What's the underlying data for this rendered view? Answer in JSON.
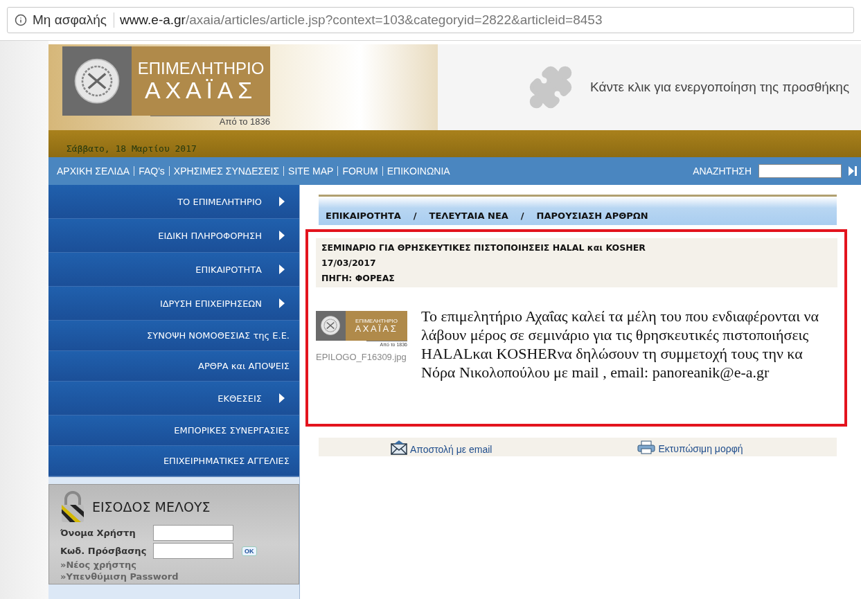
{
  "browser": {
    "security": "Μη ασφαλής",
    "url_host": "www.e-a.gr",
    "url_path": "/axaia/articles/article.jsp?context=103&categoryid=2822&articleid=8453"
  },
  "header": {
    "logo": {
      "line1": "ΕΠΙΜΕΛΗΤΗΡΙΟ",
      "line2": "ΑΧΑΪΑΣ",
      "since": "Από το 1836"
    },
    "plugin_message": "Κάντε κλικ για ενεργοποίηση της προσθήκης",
    "date": "Σάββατο, 18 Μαρτίου 2017"
  },
  "nav": {
    "links": [
      "ΑΡΧΙΚΗ ΣΕΛΙΔΑ",
      "FAQ's",
      "ΧΡΗΣΙΜΕΣ ΣΥΝΔΕΣΕΙΣ",
      "SITE MAP",
      "FORUM",
      "ΕΠΙΚΟΙΝΩΝΙΑ"
    ],
    "search_label": "ΑΝΑΖΗΤΗΣΗ"
  },
  "sidebar": {
    "items": [
      {
        "label": "ΤΟ ΕΠΙΜΕΛΗΤΗΡΙΟ",
        "has_submenu": true
      },
      {
        "label": "ΕΙΔΙΚΗ ΠΛΗΡΟΦΟΡΗΣΗ",
        "has_submenu": true
      },
      {
        "label": "ΕΠΙΚΑΙΡΟΤΗΤΑ",
        "has_submenu": true
      },
      {
        "label": "ΙΔΡΥΣΗ ΕΠΙΧΕΙΡΗΣΕΩΝ",
        "has_submenu": true
      },
      {
        "label": "ΣΥΝΟΨΗ ΝΟΜΟΘΕΣΙΑΣ της Ε.Ε.",
        "has_submenu": false
      },
      {
        "label": "ΑΡΘΡΑ και ΑΠΟΨΕΙΣ",
        "has_submenu": false
      },
      {
        "label": "ΕΚΘΕΣΕΙΣ",
        "has_submenu": true
      },
      {
        "label": "ΕΜΠΟΡΙΚΕΣ ΣΥΝΕΡΓΑΣΙΕΣ",
        "has_submenu": false
      },
      {
        "label": "ΕΠΙΧΕΙΡΗΜΑΤΙΚΕΣ ΑΓΓΕΛΙΕΣ",
        "has_submenu": false
      }
    ],
    "login": {
      "title": "ΕΙΣΟΔΟΣ ΜΕΛΟΥΣ",
      "username_label": "Όνομα Χρήστη",
      "password_label": "Κωδ. Πρόσβασης",
      "ok": "OK",
      "links": [
        "»Νέος χρήστης",
        "»Υπενθύμιση Password"
      ]
    }
  },
  "breadcrumb": [
    "ΕΠΙΚΑΙΡΟΤΗΤΑ",
    "/",
    "ΤΕΛΕΥΤΑΙΑ ΝΕΑ",
    "/",
    "ΠΑΡΟΥΣΙΑΣΗ ΑΡΘΡΩΝ"
  ],
  "article": {
    "title": "ΣΕΜΙΝΑΡΙΟ ΓΙΑ ΘΡΗΣΚΕΥΤΙΚΕΣ ΠΙΣΤΟΠΟΙΗΣΕΙΣ HALAL και KOSHER",
    "date": "17/03/2017",
    "source": "ΠΗΓΗ: ΦΟΡΕΑΣ",
    "image_logo": {
      "line1": "ΕΠΙΜΕΛΗΤΗΡΙΟ",
      "line2": "ΑΧΑΪΑΣ",
      "since": "Από το 1836"
    },
    "image_caption": "EPILOGO_F16309.jpg",
    "body": "Το επιμελητήριο Αχαΐας καλεί τα μέλη του που ενδιαφέρονται να λάβουν μέρος σε σεμινάριο για τις θρησκευτικές πιστοποιήσεις HALALκαι KOSHERνα δηλώσουν τη συμμετοχή τους την κα Νόρα Νικολοπούλου με mail , email: panoreanik@e-a.gr",
    "highlighted": true
  },
  "actions": [
    "Αποστολή με email",
    "Εκτυπώσιμη μορφή"
  ]
}
